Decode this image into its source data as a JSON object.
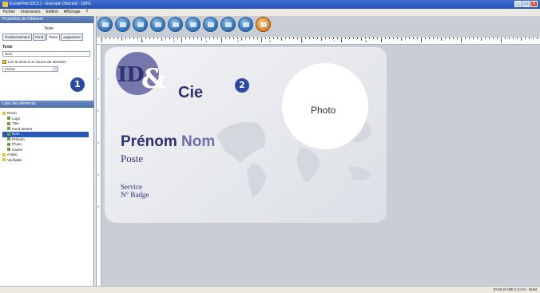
{
  "window": {
    "title": "EvolisPrint IDC3.1 - Exemple Dfvd.tod - 100%",
    "controls": [
      "_",
      "□",
      "X"
    ]
  },
  "menu": [
    "Fichier",
    "Impression",
    "Edition",
    "Affichage",
    "?"
  ],
  "left_panel": {
    "header": "Propriétés de l'élément",
    "section_title": "Texte",
    "tabs": [
      "Positionnement",
      "Fond",
      "Texte",
      "Apparence"
    ],
    "active_tab": "Texte",
    "field_label": "Texte",
    "field_value": "Nom",
    "checkbox_label": "Lier le texte à un source de données",
    "select_value": "Fichier",
    "badge": "1"
  },
  "tree_panel": {
    "header": "Liste des éléments",
    "items": [
      {
        "label": "Recto",
        "indent": 0,
        "selected": false
      },
      {
        "label": "Logo",
        "indent": 1,
        "selected": false
      },
      {
        "label": "Titre",
        "indent": 1,
        "selected": false
      },
      {
        "label": "Fond dentrer",
        "indent": 1,
        "selected": false
      },
      {
        "label": "Nom",
        "indent": 1,
        "selected": true
      },
      {
        "label": "Prénom",
        "indent": 1,
        "selected": false
      },
      {
        "label": "Photo",
        "indent": 1,
        "selected": false
      },
      {
        "label": "Cache",
        "indent": 1,
        "selected": false
      },
      {
        "label": "Arabic",
        "indent": 0,
        "selected": false
      },
      {
        "label": "Verifiable",
        "indent": 0,
        "selected": false
      }
    ]
  },
  "toolbar": {
    "buttons": [
      "new-icon",
      "open-icon",
      "save-icon",
      "print-icon",
      "preview-icon",
      "text-icon",
      "image-icon",
      "shape-icon",
      "barcode-icon",
      "encode-icon"
    ]
  },
  "ruler": {
    "h_labels": [
      "1",
      "2",
      "3",
      "4",
      "5",
      "6",
      "7",
      "8"
    ],
    "v_labels": [
      "1",
      "2",
      "3",
      "4",
      "5"
    ]
  },
  "card": {
    "logo_id": "ID",
    "logo_amp": "&",
    "logo_cie": "Cie",
    "badge": "2",
    "photo_label": "Photo",
    "first_name": "Prénom",
    "last_name": "Nom",
    "poste": "Poste",
    "service": "Service",
    "badge_no": "N° Badge"
  },
  "statusbar": {
    "right_text": "EVOLIS IDE 2.0.0.0 - NUM"
  },
  "colors": {
    "brand_dark": "#2e3370",
    "brand_purple": "#7678ad",
    "badge": "#2c4a9e",
    "selection": "#2a58b8"
  }
}
